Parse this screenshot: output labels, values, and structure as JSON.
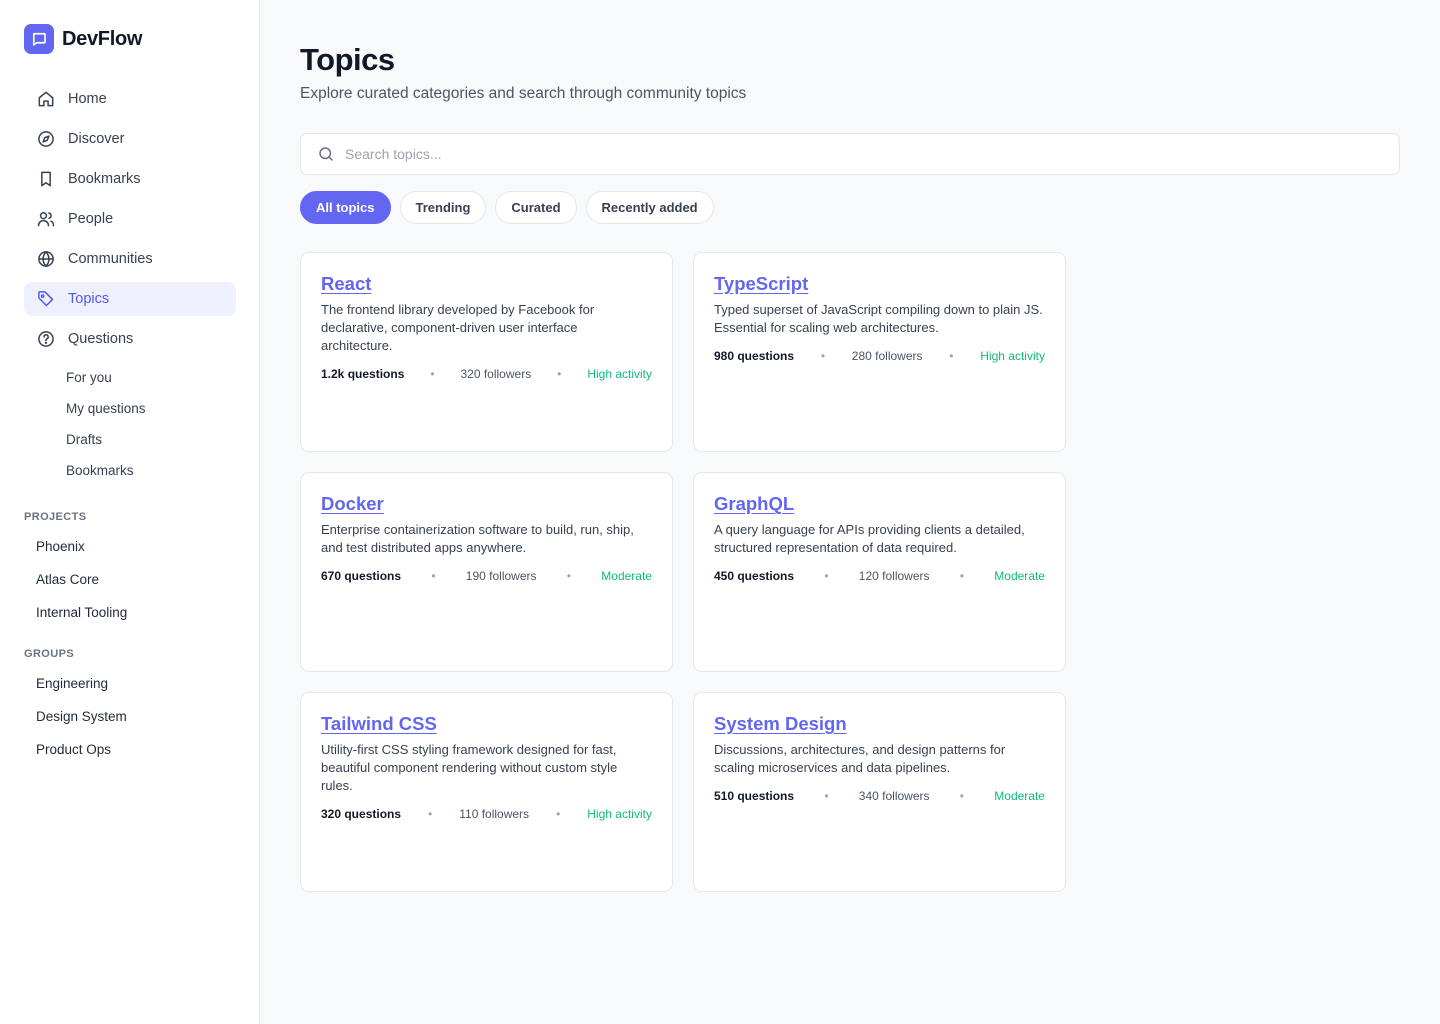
{
  "app": {
    "name": "DevFlow"
  },
  "colors": {
    "accent": "#6366f1",
    "activity": "#10b981"
  },
  "nav": [
    {
      "label": "Home",
      "icon": "home-icon"
    },
    {
      "label": "Discover",
      "icon": "compass-icon"
    },
    {
      "label": "Bookmarks",
      "icon": "bookmark-icon"
    },
    {
      "label": "People",
      "icon": "people-icon"
    },
    {
      "label": "Communities",
      "icon": "globe-icon"
    },
    {
      "label": "Topics",
      "icon": "tag-icon",
      "active": true
    },
    {
      "label": "Questions",
      "icon": "question-icon"
    }
  ],
  "questions_sub": [
    "For you",
    "My questions",
    "Drafts",
    "Bookmarks"
  ],
  "projects": {
    "title": "PROJECTS",
    "items": [
      "Phoenix",
      "Atlas Core",
      "Internal Tooling"
    ]
  },
  "groups": {
    "title": "GROUPS",
    "items": [
      "Engineering",
      "Design System",
      "Product Ops"
    ]
  },
  "page": {
    "title": "Topics",
    "subtitle": "Explore curated categories and search through community topics"
  },
  "search": {
    "placeholder": "Search topics..."
  },
  "filters": [
    {
      "label": "All topics",
      "active": true
    },
    {
      "label": "Trending"
    },
    {
      "label": "Curated"
    },
    {
      "label": "Recently added"
    }
  ],
  "topics": [
    {
      "title": "React",
      "desc": "The frontend library developed by Facebook for declarative, component-driven user interface architecture.",
      "questions": "1.2k questions",
      "followers": "320 followers",
      "activity": "High activity"
    },
    {
      "title": "TypeScript",
      "desc": "Typed superset of JavaScript compiling down to plain JS. Essential for scaling web architectures.",
      "questions": "980 questions",
      "followers": "280 followers",
      "activity": "High activity"
    },
    {
      "title": "Docker",
      "desc": "Enterprise containerization software to build, run, ship, and test distributed apps anywhere.",
      "questions": "670 questions",
      "followers": "190 followers",
      "activity": "Moderate"
    },
    {
      "title": "GraphQL",
      "desc": "A query language for APIs providing clients a detailed, structured representation of data required.",
      "questions": "450 questions",
      "followers": "120 followers",
      "activity": "Moderate"
    },
    {
      "title": "Tailwind CSS",
      "desc": "Utility-first CSS styling framework designed for fast, beautiful component rendering without custom style rules.",
      "questions": "320 questions",
      "followers": "110 followers",
      "activity": "High activity"
    },
    {
      "title": "System Design",
      "desc": "Discussions, architectures, and design patterns for scaling microservices and data pipelines.",
      "questions": "510 questions",
      "followers": "340 followers",
      "activity": "Moderate"
    }
  ]
}
